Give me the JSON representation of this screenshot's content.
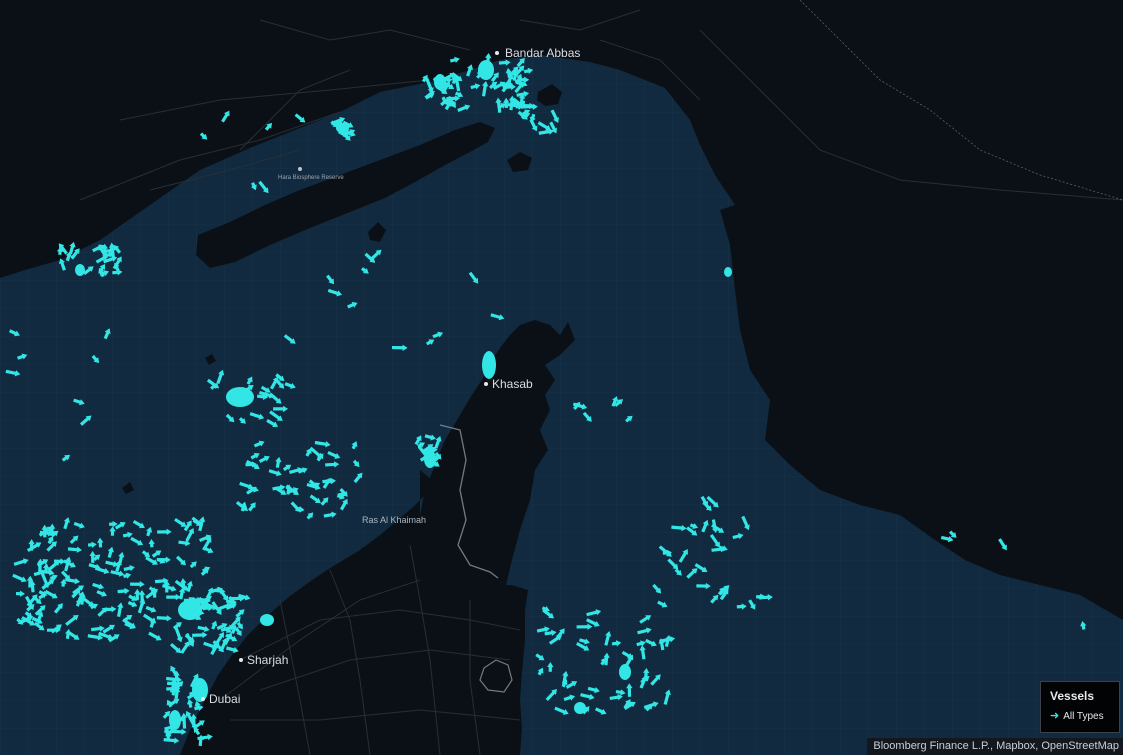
{
  "map": {
    "colors": {
      "water": "#112a3f",
      "land": "#0b1016",
      "grid": "#1f4058",
      "roads": "#2a3037",
      "border": "#8e959c",
      "vessel": "#33e6e6"
    },
    "places": [
      {
        "id": "bandar-abbas",
        "label": "Bandar Abbas"
      },
      {
        "id": "hara-reserve",
        "label": "Hara Biosphere Reserve"
      },
      {
        "id": "khasab",
        "label": "Khasab"
      },
      {
        "id": "ras-al-khaimah",
        "label": "Ras Al Khaimah"
      },
      {
        "id": "sharjah",
        "label": "Sharjah"
      },
      {
        "id": "dubai",
        "label": "Dubai"
      }
    ]
  },
  "legend": {
    "title": "Vessels",
    "items": [
      {
        "label": "All Types",
        "icon": "vessel-arrow-icon"
      }
    ]
  },
  "attribution": "Bloomberg Finance L.P., Mapbox, OpenStreetMap"
}
